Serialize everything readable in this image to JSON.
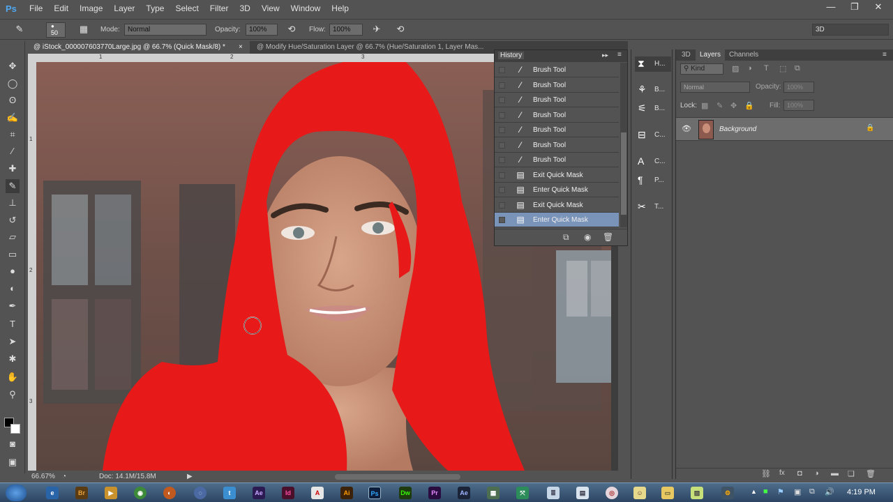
{
  "app": {
    "logo": "Ps"
  },
  "menu": {
    "items": [
      "File",
      "Edit",
      "Image",
      "Layer",
      "Type",
      "Select",
      "Filter",
      "3D",
      "View",
      "Window",
      "Help"
    ]
  },
  "window_controls": {
    "minimize": "—",
    "restore": "❐",
    "close": "✕"
  },
  "options": {
    "brush_size": "50",
    "mode_label": "Mode:",
    "mode_value": "Normal",
    "opacity_label": "Opacity:",
    "opacity_value": "100%",
    "flow_label": "Flow:",
    "flow_value": "100%",
    "workspace": "3D"
  },
  "tabs": [
    {
      "label": "@ iStock_000007603770Large.jpg @ 66.7% (Quick Mask/8) *",
      "close": "×"
    },
    {
      "label": "@ Modify Hue/Saturation Layer @ 66.7% (Hue/Saturation 1, Layer Mas..."
    }
  ],
  "status": {
    "zoom": "66.67%",
    "doc": "Doc: 14.1M/15.8M"
  },
  "ruler": {
    "top": [
      "1",
      "2",
      "3"
    ],
    "left": [
      "1",
      "2",
      "3"
    ]
  },
  "history": {
    "title": "History",
    "items": [
      {
        "label": "Brush Tool",
        "icon": "brush-icon"
      },
      {
        "label": "Brush Tool",
        "icon": "brush-icon"
      },
      {
        "label": "Brush Tool",
        "icon": "brush-icon"
      },
      {
        "label": "Brush Tool",
        "icon": "brush-icon"
      },
      {
        "label": "Brush Tool",
        "icon": "brush-icon"
      },
      {
        "label": "Brush Tool",
        "icon": "brush-icon"
      },
      {
        "label": "Brush Tool",
        "icon": "brush-icon"
      },
      {
        "label": "Exit Quick Mask",
        "icon": "document-icon"
      },
      {
        "label": "Enter Quick Mask",
        "icon": "document-icon"
      },
      {
        "label": "Exit Quick Mask",
        "icon": "document-icon"
      },
      {
        "label": "Enter Quick Mask",
        "icon": "document-icon",
        "selected": true
      }
    ]
  },
  "dock": {
    "items": [
      {
        "label": "H...",
        "icon": "history-icon"
      },
      {
        "label": "B...",
        "icon": "brush-presets-icon"
      },
      {
        "label": "B...",
        "icon": "brush-icon"
      },
      {
        "label": "C...",
        "icon": "clone-source-icon"
      },
      {
        "label": "C...",
        "icon": "character-icon"
      },
      {
        "label": "P...",
        "icon": "paragraph-icon"
      },
      {
        "label": "T...",
        "icon": "tool-presets-icon"
      }
    ]
  },
  "layers_panel": {
    "tabs": [
      "3D",
      "Layers",
      "Channels"
    ],
    "active_tab": "Layers",
    "kind": "Kind",
    "blend_mode": "Normal",
    "opacity_label": "Opacity:",
    "opacity_value": "100%",
    "lock_label": "Lock:",
    "fill_label": "Fill:",
    "fill_value": "100%",
    "layers": [
      {
        "name": "Background",
        "visible": true,
        "locked": true
      }
    ]
  },
  "taskbar": {
    "apps": [
      "Br",
      "Ae",
      "Id",
      "Ai",
      "Ps",
      "Dw",
      "Pr",
      "Ae"
    ],
    "clock": "4:19 PM"
  },
  "colors": {
    "panel_bg": "#535353",
    "mask_red": "#e81919",
    "history_selected": "#7a93b8"
  }
}
